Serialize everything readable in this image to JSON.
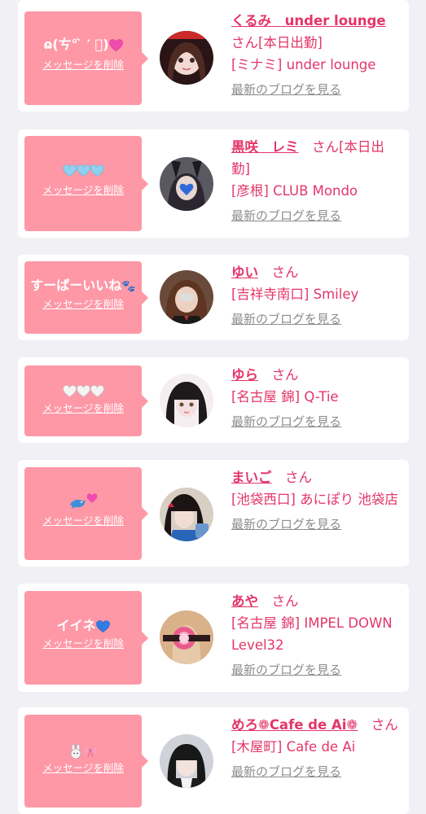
{
  "delete_label": "メッセージを削除",
  "blog_label": "最新のブログを見る",
  "san_label": "さん",
  "colors": {
    "accent": "#e4356a",
    "bubble": "#fe98a7",
    "card": "#ffffff",
    "background": "#f1f0f4",
    "link_gray": "#8c8c8c"
  },
  "cards": [
    {
      "message": "ɷ(ㄘ°  ̀ ′ ゚)",
      "message_icon": "pink-heart-icon",
      "name": "くるみ　under lounge",
      "suffix": "さん[本日出勤]",
      "shop": "[ミナミ] under lounge"
    },
    {
      "message": "",
      "message_icon": "three-light-blue-hearts-icon",
      "name": "黒咲　レミ",
      "suffix": "さん[本日出勤]",
      "shop": "[彦根] CLUB Mondo"
    },
    {
      "message": "すーぱーいいね",
      "message_icon": "paw-prints-icon",
      "name": "ゆい",
      "suffix": "さん",
      "shop": "[吉祥寺南口] Smiley"
    },
    {
      "message": "",
      "message_icon": "three-white-hearts-icon",
      "name": "ゆら",
      "suffix": "さん",
      "shop": "[名古屋 錦] Q-Tie"
    },
    {
      "message": "",
      "message_icon": "dolphin-and-hearts-icon",
      "name": "まいご",
      "suffix": "さん",
      "shop": "[池袋西口] あにぽり 池袋店"
    },
    {
      "message": "イイネ",
      "message_icon": "blue-heart-icon",
      "name": "あや",
      "suffix": "さん",
      "shop": "[名古屋 錦] IMPEL DOWN Level32"
    },
    {
      "message": "",
      "message_icon": "bunny-and-ribbon-icon",
      "name": "めろ❁Cafe de Ai❁",
      "suffix": "さん",
      "shop": "[木屋町] Cafe de Ai"
    }
  ]
}
